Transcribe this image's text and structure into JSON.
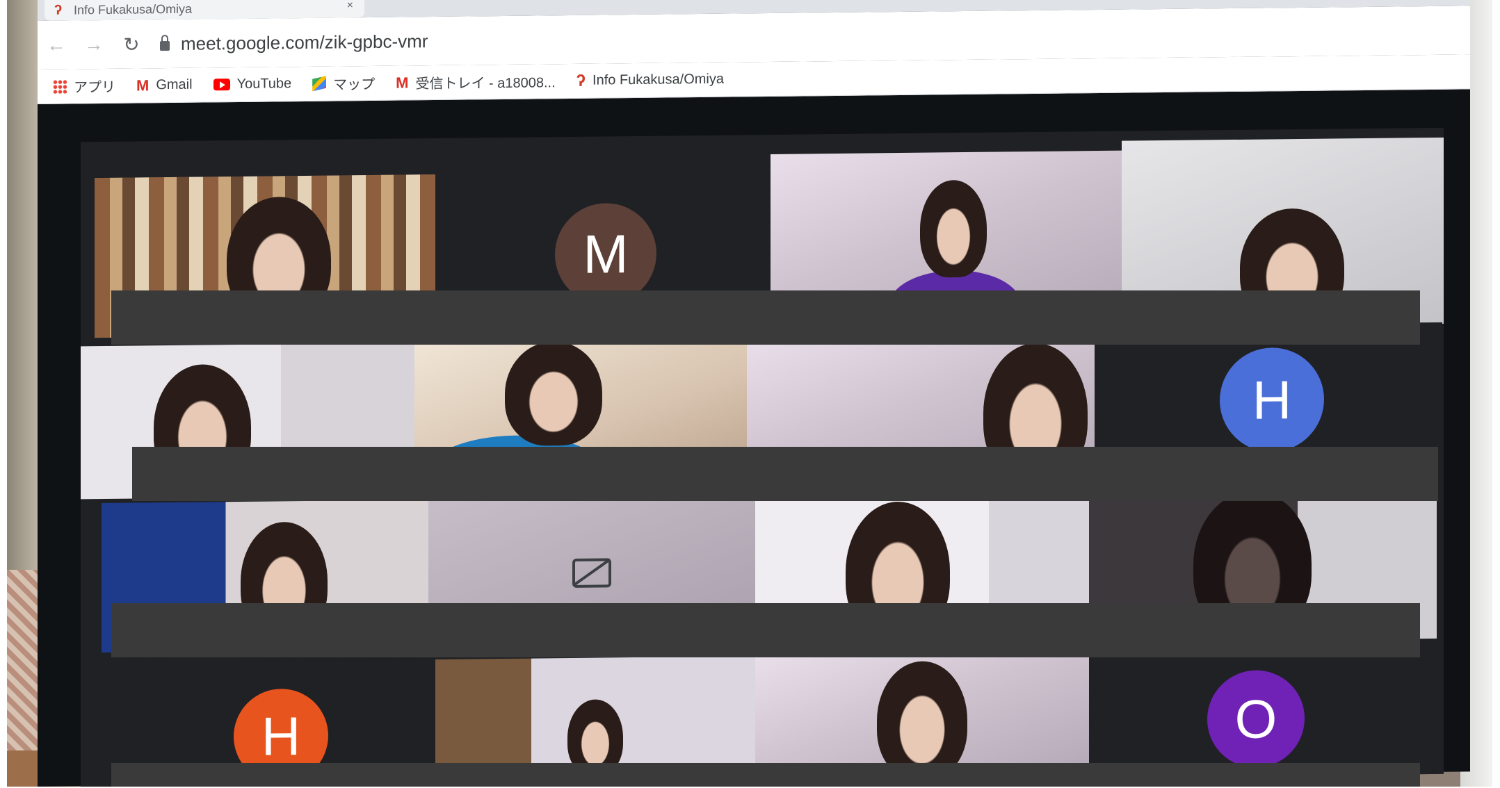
{
  "browser": {
    "tab": {
      "title": "Info Fukakusa/Omiya",
      "close": "×"
    },
    "nav": {
      "back": "←",
      "forward": "→",
      "reload": "↻"
    },
    "url": "meet.google.com/zik-gpbc-vmr",
    "bookmarks": [
      {
        "label": "アプリ",
        "icon": "apps-grid-icon"
      },
      {
        "label": "Gmail",
        "icon": "gmail-icon",
        "glyph": "M"
      },
      {
        "label": "YouTube",
        "icon": "youtube-icon"
      },
      {
        "label": "マップ",
        "icon": "maps-icon"
      },
      {
        "label": "受信トレイ - a18008...",
        "icon": "gmail-icon",
        "glyph": "M"
      },
      {
        "label": "Info Fukakusa/Omiya",
        "icon": "info-logo-icon",
        "glyph": "ʔ"
      }
    ]
  },
  "meet": {
    "avatars": [
      {
        "initial": "M",
        "color": "#5d4037"
      },
      {
        "initial": "H",
        "color": "#4a6fd8"
      },
      {
        "initial": "H",
        "color": "#e8541e"
      },
      {
        "initial": "O",
        "color": "#6f22b5"
      }
    ],
    "colors": {
      "background": "#202124",
      "redaction": "#3a3a3a"
    }
  }
}
